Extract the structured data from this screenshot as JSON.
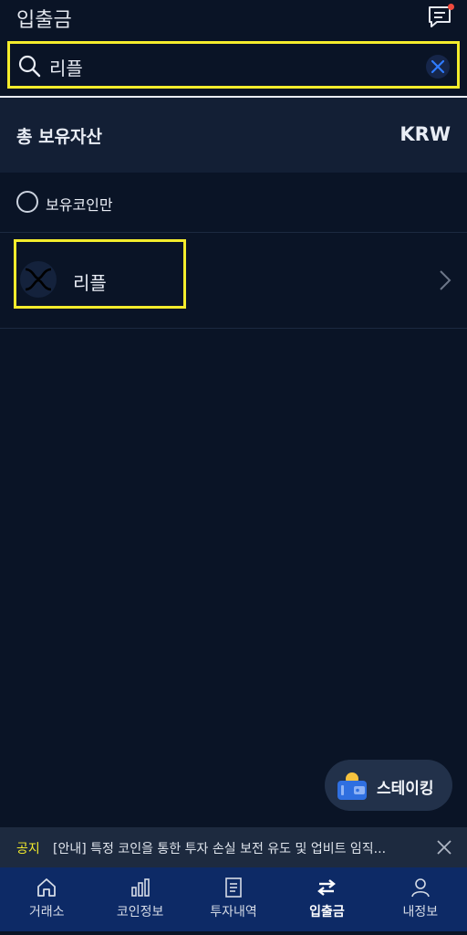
{
  "header": {
    "title": "입출금",
    "chat_icon": "chat-icon",
    "notification_color": "#f04a3e"
  },
  "search": {
    "value": "리플",
    "search_icon": "search-icon",
    "clear_icon": "close-icon",
    "highlight_color": "#f4ec2c"
  },
  "summary": {
    "label": "총 보유자산",
    "currency": "KRW"
  },
  "filter": {
    "label": "보유코인만",
    "checked": false
  },
  "coins": [
    {
      "name": "리플",
      "icon": "xrp-icon"
    }
  ],
  "staking": {
    "label": "스테이킹",
    "icon": "wallet-icon"
  },
  "notice": {
    "tag": "공지",
    "text": "[안내] 특정 코인을 통한 투자 손실 보전 유도 및 업비트 임직..."
  },
  "tabs": [
    {
      "label": "거래소",
      "icon": "home-icon",
      "active": false
    },
    {
      "label": "코인정보",
      "icon": "chart-icon",
      "active": false
    },
    {
      "label": "투자내역",
      "icon": "list-icon",
      "active": false
    },
    {
      "label": "입출금",
      "icon": "transfer-icon",
      "active": true
    },
    {
      "label": "내정보",
      "icon": "user-icon",
      "active": false
    }
  ],
  "colors": {
    "background": "#0a1426",
    "tabbar": "#0d2a66",
    "accent": "#f4ec2c"
  }
}
